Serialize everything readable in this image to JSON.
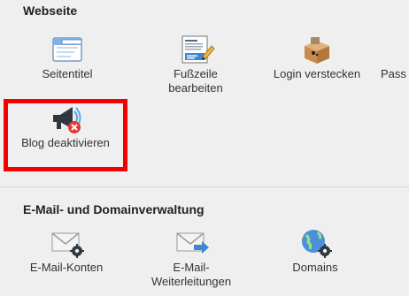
{
  "sections": {
    "webseite": {
      "title": "Webseite",
      "items": [
        {
          "label": "Seitentitel",
          "icon": "window-title-icon"
        },
        {
          "label": "Fußzeile\nbearbeiten",
          "icon": "footer-edit-icon"
        },
        {
          "label": "Login verstecken",
          "icon": "hide-login-icon"
        },
        {
          "label": "Pass",
          "icon": "password-icon"
        },
        {
          "label": "Blog deaktivieren",
          "icon": "blog-disable-icon",
          "highlighted": true
        }
      ]
    },
    "email": {
      "title": "E-Mail- und Domainverwaltung",
      "items": [
        {
          "label": "E-Mail-Konten",
          "icon": "email-accounts-icon"
        },
        {
          "label": "E-Mail-\nWeiterleitungen",
          "icon": "email-forwarding-icon"
        },
        {
          "label": "Domains",
          "icon": "domains-icon"
        }
      ]
    }
  },
  "colors": {
    "background": "#efefef",
    "highlight": "#f40000",
    "accent_blue": "#3d86d0"
  }
}
